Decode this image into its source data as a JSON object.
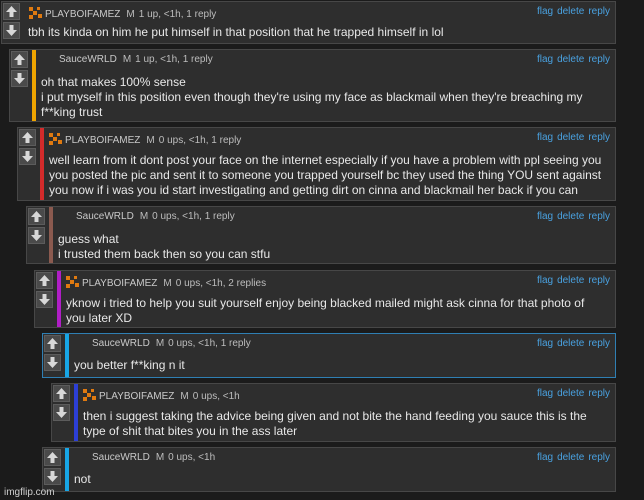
{
  "actions": {
    "flag": "flag",
    "delete": "delete",
    "reply": "reply"
  },
  "mod_label": "M",
  "colors": {
    "bar_orange": "#f0a500",
    "bar_red": "#d32b2b",
    "bar_purple": "#b01ec6",
    "bar_cyan": "#17a6e6",
    "bar_blue": "#2c3fd6",
    "bar_brown": "#8b5a4f",
    "link": "#49a1e0"
  },
  "icons": {
    "upvote": "up-arrow-icon",
    "downvote": "down-arrow-icon",
    "avatar": "pixel-avatar-icon"
  },
  "comments": [
    {
      "user": "PLAYBOIFAMEZ",
      "meta": "1 up, <1h, 1 reply",
      "lines": [
        "tbh its kinda on him he put himself in that position that he trapped himself in lol"
      ]
    },
    {
      "user": "SauceWRLD",
      "meta": "1 up, <1h, 1 reply",
      "lines": [
        "oh that makes 100% sense",
        "i put myself in this position even though they're using my face as blackmail when they're breaching my",
        "f**king trust"
      ]
    },
    {
      "user": "PLAYBOIFAMEZ",
      "meta": "0 ups, <1h, 1 reply",
      "lines": [
        "well learn from it dont post your face on the internet especially if you have a problem with ppl seeing you",
        "you posted the pic and sent it to someone you trapped yourself bc they used the thing YOU sent against",
        "you now if i was you id start investigating and getting dirt on cinna and blackmail her back if you can"
      ]
    },
    {
      "user": "SauceWRLD",
      "meta": "0 ups, <1h, 1 reply",
      "lines": [
        "guess what",
        "i trusted them back then so you can stfu"
      ]
    },
    {
      "user": "PLAYBOIFAMEZ",
      "meta": "0 ups, <1h, 2 replies",
      "lines": [
        "yknow i tried to help you suit yourself enjoy being blacked mailed might ask cinna for that photo of",
        "you later XD"
      ]
    },
    {
      "user": "SauceWRLD",
      "meta": "0 ups, <1h, 1 reply",
      "lines": [
        "you better f**king n it"
      ]
    },
    {
      "user": "PLAYBOIFAMEZ",
      "meta": "0 ups, <1h",
      "lines": [
        "then i suggest taking the advice being given and not bite the hand feeding you sauce this is the",
        "type of shit that bites you in the ass later"
      ]
    },
    {
      "user": "SauceWRLD",
      "meta": "0 ups, <1h",
      "lines": [
        "not"
      ]
    }
  ],
  "watermark": "imgflip.com"
}
